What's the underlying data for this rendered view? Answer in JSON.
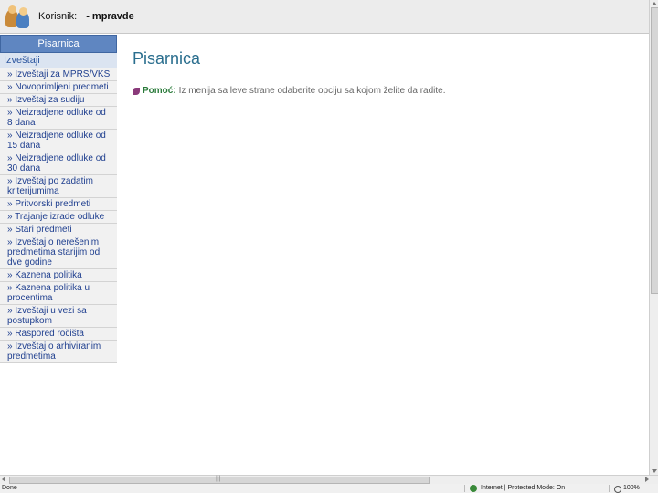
{
  "header": {
    "user_label": "Korisnik:",
    "user_name": "- mpravde"
  },
  "sidebar": {
    "header": "Pisarnica",
    "section": "Izveštaji",
    "items": [
      "» Izveštaji za MPRS/VKS",
      "» Novoprimljeni predmeti",
      "» Izveštaj za sudiju",
      "» Neizradjene odluke od 8 dana",
      "» Neizradjene odluke od 15 dana",
      "» Neizradjene odluke od 30 dana",
      "» Izveštaj po zadatim kriterijumima",
      "» Pritvorski predmeti",
      "» Trajanje izrade odluke",
      "» Stari predmeti",
      "» Izveštaj o nerešenim predmetima starijim od dve godine",
      "» Kaznena politika",
      "» Kaznena politika u procentima",
      "» Izveštaji u vezi sa postupkom",
      "» Raspored ročišta",
      "» Izveštaj o arhiviranim predmetima"
    ]
  },
  "main": {
    "title": "Pisarnica",
    "help_label": "Pomoć:",
    "help_text": "Iz menija sa leve strane odaberite opciju sa kojom želite da radite."
  },
  "statusbar": {
    "left": "Done",
    "zone": "Internet | Protected Mode: On",
    "zoom": "100%"
  },
  "colors": {
    "sidebar_header": "#5f86c1",
    "sidebar_section": "#dbe4f1",
    "link": "#1f3f8f",
    "title": "#2a6e8e",
    "help_label": "#2a7a3a"
  }
}
